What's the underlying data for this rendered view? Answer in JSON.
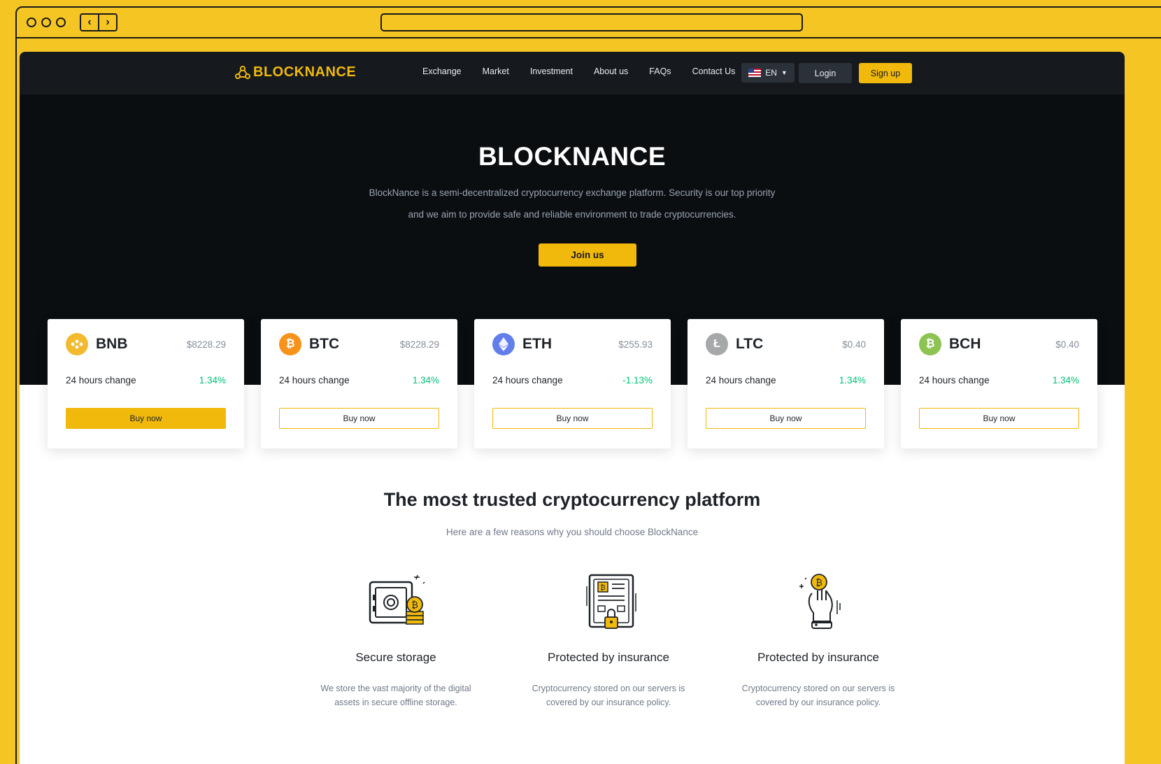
{
  "nav": {
    "logo": "BLOCKNANCE",
    "menu": [
      "Exchange",
      "Market",
      "Investment",
      "About us",
      "FAQs",
      "Contact Us"
    ],
    "lang": "EN",
    "login": "Login",
    "signup": "Sign up"
  },
  "hero": {
    "title": "BLOCKNANCE",
    "desc_line1": "BlockNance is a semi-decentralized cryptocurrency exchange platform. Security is our top priority",
    "desc_line2": "and we aim to provide safe and reliable environment to trade cryptocurrencies.",
    "cta": "Join us"
  },
  "coins": [
    {
      "symbol": "BNB",
      "price": "$8228.29",
      "change_label": "24 hours change",
      "change": "1.34%",
      "buy": "Buy now",
      "icon": "bnb-icon",
      "color": "#f3ba2f"
    },
    {
      "symbol": "BTC",
      "price": "$8228.29",
      "change_label": "24 hours change",
      "change": "1.34%",
      "buy": "Buy now",
      "icon": "btc-icon",
      "color": "#f7931a"
    },
    {
      "symbol": "ETH",
      "price": "$255.93",
      "change_label": "24 hours change",
      "change": "-1.13%",
      "buy": "Buy now",
      "icon": "eth-icon",
      "color": "#627eea"
    },
    {
      "symbol": "LTC",
      "price": "$0.40",
      "change_label": "24 hours change",
      "change": "1.34%",
      "buy": "Buy now",
      "icon": "ltc-icon",
      "color": "#a6a9aa"
    },
    {
      "symbol": "BCH",
      "price": "$0.40",
      "change_label": "24 hours change",
      "change": "1.34%",
      "buy": "Buy now",
      "icon": "bch-icon",
      "color": "#8dc351"
    }
  ],
  "trusted": {
    "title": "The most trusted cryptocurrency platform",
    "subtitle": "Here are a few reasons why you should choose BlockNance",
    "features": [
      {
        "title": "Secure storage",
        "line1": "We store the vast majority of the digital",
        "line2": "assets in secure offline storage.",
        "icon": "safe-icon"
      },
      {
        "title": "Protected by insurance",
        "line1": "Cryptocurrency stored on our servers is",
        "line2": "covered by our insurance policy.",
        "icon": "insurance-document-icon"
      },
      {
        "title": "Protected by insurance",
        "line1": "Cryptocurrency stored on our servers is",
        "line2": "covered by our insurance policy.",
        "icon": "hand-coin-icon"
      }
    ]
  },
  "colors": {
    "accent": "#f0b90b",
    "positive": "#02c076",
    "dark": "#0b0e11"
  }
}
